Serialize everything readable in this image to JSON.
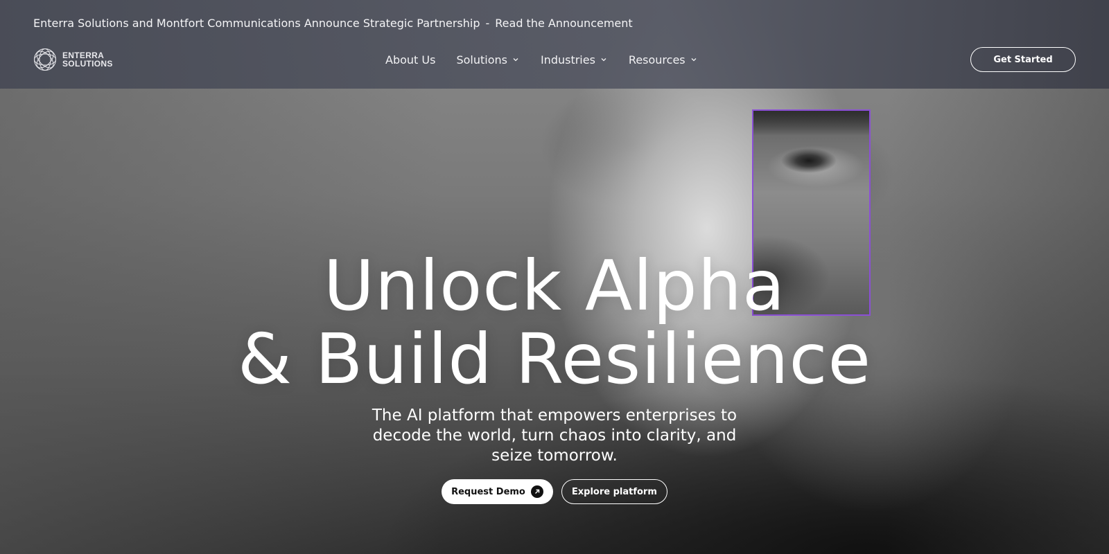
{
  "announcement": {
    "text": "Enterra Solutions and Montfort Communications Announce Strategic Partnership",
    "separator": "-",
    "link": "Read the Announcement"
  },
  "logo": {
    "line1": "ENTERRA",
    "line2": "SOLUTIONS",
    "icon": "globe-rings-logo-icon"
  },
  "nav": {
    "items": [
      {
        "label": "About Us",
        "has_dropdown": false
      },
      {
        "label": "Solutions",
        "has_dropdown": true
      },
      {
        "label": "Industries",
        "has_dropdown": true
      },
      {
        "label": "Resources",
        "has_dropdown": true
      }
    ]
  },
  "header": {
    "cta_label": "Get Started"
  },
  "hero": {
    "headline_line1": "Unlock Alpha",
    "headline_line2": "& Build Resilience",
    "subheadline": "The AI platform that empowers enterprises to decode the world, turn chaos into clarity, and seize tomorrow.",
    "primary_cta": "Request Demo",
    "secondary_cta": "Explore platform"
  },
  "colors": {
    "accent_focus_box": "#8b4fd6",
    "header_band": "#4b4e5a",
    "text": "#ffffff"
  }
}
